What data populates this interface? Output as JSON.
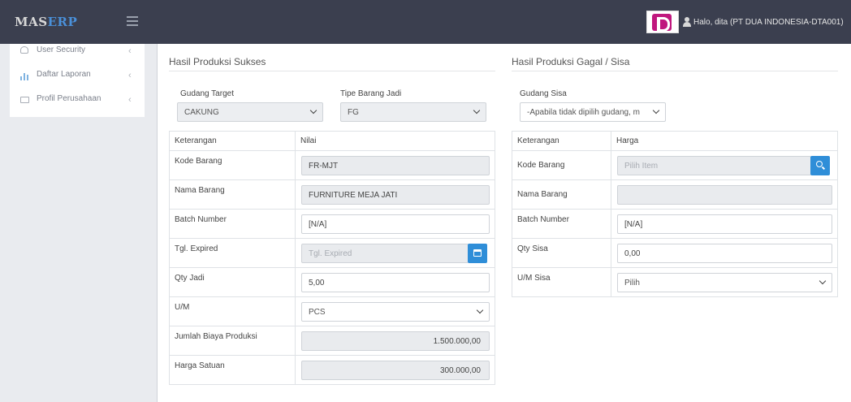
{
  "topbar": {
    "logo_part1": "MAS",
    "logo_part2": "ERP",
    "greeting": "Halo, dita (PT DUA INDONESIA-DTA001)"
  },
  "sidebar": {
    "items": [
      {
        "label": "User Security",
        "icon": "users-icon"
      },
      {
        "label": "Daftar Laporan",
        "icon": "bar-chart-icon"
      },
      {
        "label": "Profil Perusahaan",
        "icon": "window-icon"
      }
    ],
    "chevron": "‹"
  },
  "success": {
    "title": "Hasil Produksi Sukses",
    "gudang_label": "Gudang Target",
    "gudang_value": "CAKUNG",
    "tipe_label": "Tipe Barang Jadi",
    "tipe_value": "FG",
    "col_key": "Keterangan",
    "col_val": "Nilai",
    "rows": [
      {
        "label": "Kode Barang",
        "value": "FR-MJT"
      },
      {
        "label": "Nama Barang",
        "value": "FURNITURE MEJA JATI"
      },
      {
        "label": "Batch Number",
        "value": "[N/A]"
      },
      {
        "label": "Tgl. Expired",
        "placeholder": "Tgl. Expired"
      },
      {
        "label": "Qty Jadi",
        "value": "5,00"
      },
      {
        "label": "U/M",
        "value": "PCS"
      },
      {
        "label": "Jumlah Biaya Produksi",
        "value": "1.500.000,00"
      },
      {
        "label": "Harga Satuan",
        "value": "300.000,00"
      }
    ]
  },
  "failed": {
    "title": "Hasil Produksi Gagal / Sisa",
    "gudang_label": "Gudang Sisa",
    "gudang_value": "-Apabila tidak dipilih gudang, m",
    "col_key": "Keterangan",
    "col_val": "Harga",
    "rows": [
      {
        "label": "Kode Barang",
        "placeholder": "Pilih Item"
      },
      {
        "label": "Nama Barang",
        "value": ""
      },
      {
        "label": "Batch Number",
        "value": "[N/A]"
      },
      {
        "label": "Qty Sisa",
        "value": "0,00"
      },
      {
        "label": "U/M Sisa",
        "value": "Pilih"
      }
    ]
  }
}
